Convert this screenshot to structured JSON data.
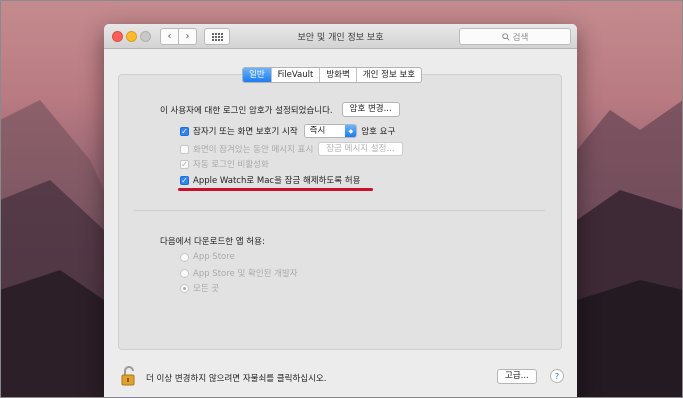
{
  "window": {
    "title": "보안 및 개인 정보 보호",
    "search_placeholder": "검색",
    "nav_back": "‹",
    "nav_forward": "›"
  },
  "tabs": [
    {
      "label": "일반",
      "active": true
    },
    {
      "label": "FileVault",
      "active": false
    },
    {
      "label": "방화벽",
      "active": false
    },
    {
      "label": "개인 정보 보호",
      "active": false
    }
  ],
  "general": {
    "login_password_text": "이 사용자에 대한 로그인 암호가 설정되었습니다.",
    "change_password_button": "암호 변경...",
    "require_password_label": "잠자기 또는 화면 보호기 시작",
    "require_password_value": "즉시",
    "require_password_suffix": "암호 요구",
    "show_message_label": "화면이 잠겨있는 동안 메시지 표시",
    "set_message_button": "잠금 메시지 설정...",
    "disable_auto_login_label": "자동 로그인 비활성화",
    "apple_watch_label": "Apple Watch로 Mac을 잠금 해제하도록 허용",
    "download_heading": "다음에서 다운로드한 앱 허용:",
    "radio_options": [
      {
        "label": "App Store",
        "selected": false
      },
      {
        "label": "App Store 및 확인된 개발자",
        "selected": false
      },
      {
        "label": "모든 곳",
        "selected": true
      }
    ]
  },
  "footer": {
    "lock_text": "더 이상 변경하지 않으려면 자물쇠를 클릭하십시오.",
    "advanced_button": "고급...",
    "help_button": "?"
  },
  "colors": {
    "accent": "#1b7cf2",
    "annotation": "#c8102e"
  }
}
